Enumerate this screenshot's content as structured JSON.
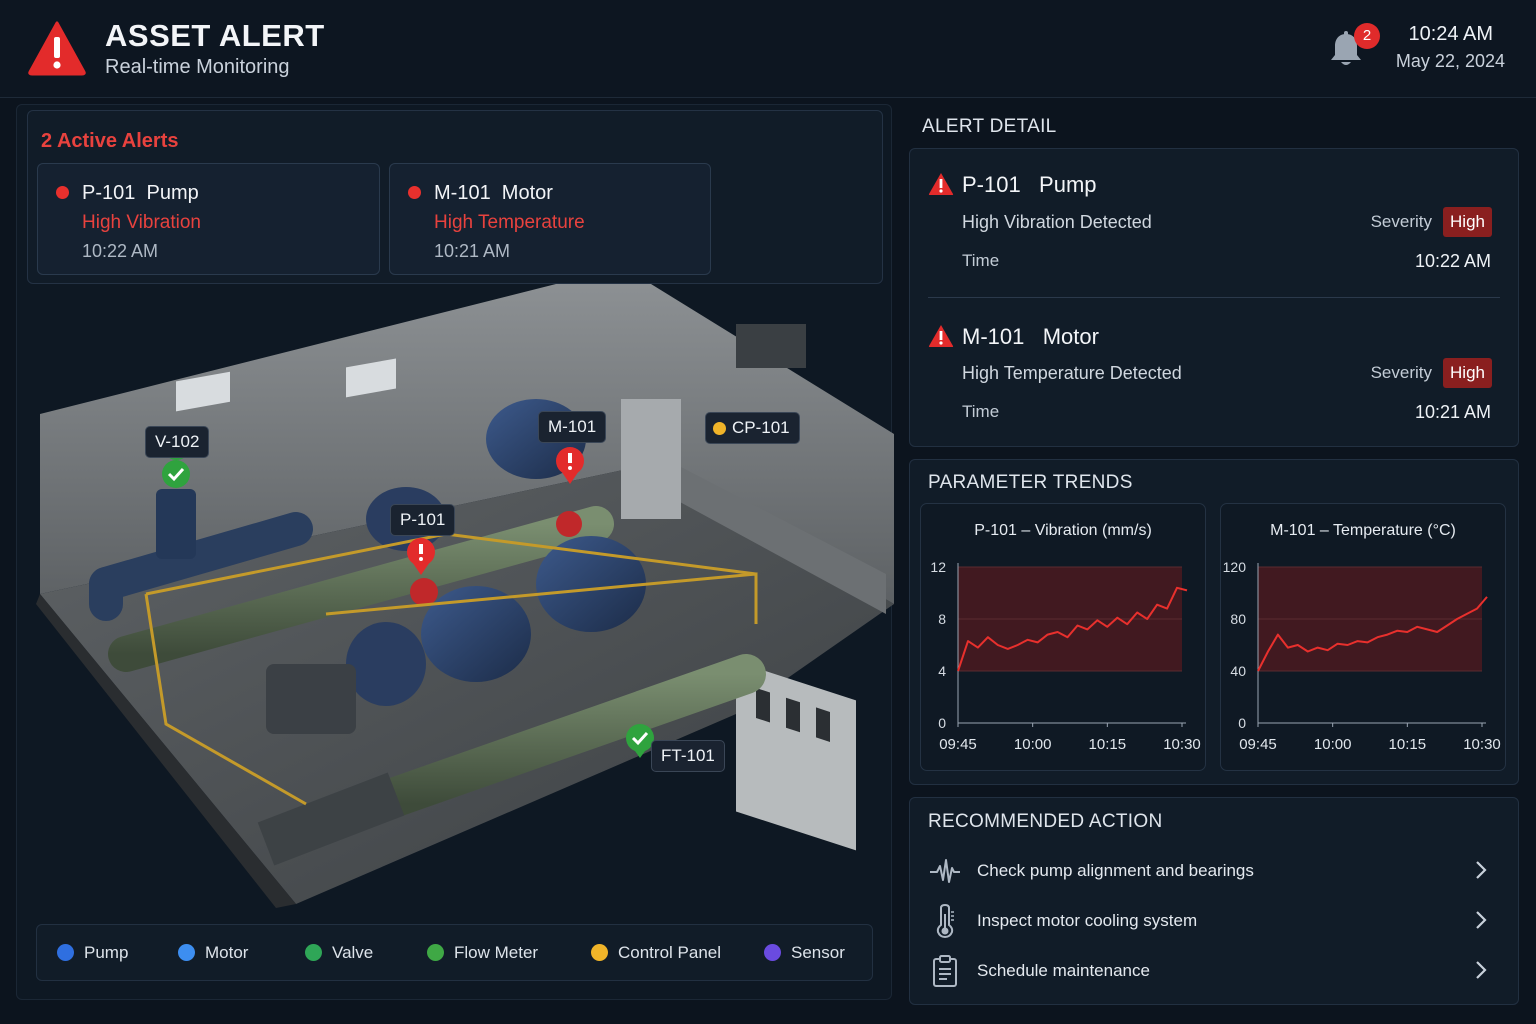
{
  "header": {
    "title": "ASSET ALERT",
    "subtitle": "Real-time Monitoring",
    "notification_count": "2",
    "time": "10:24 AM",
    "date": "May 22, 2024"
  },
  "alerts": {
    "title": "2 Active Alerts",
    "items": [
      {
        "name": "P-101  Pump",
        "issue": "High Vibration",
        "time": "10:22 AM"
      },
      {
        "name": "M-101  Motor",
        "issue": "High Temperature",
        "time": "10:21 AM"
      }
    ]
  },
  "plant": {
    "markers": [
      {
        "label": "V-102",
        "status": "ok"
      },
      {
        "label": "M-101",
        "status": "alert"
      },
      {
        "label": "CP-101",
        "status": "panel"
      },
      {
        "label": "P-101",
        "status": "alert"
      },
      {
        "label": "FT-101",
        "status": "ok"
      }
    ]
  },
  "legend": [
    {
      "label": "Pump",
      "color": "#2f6fe0"
    },
    {
      "label": "Motor",
      "color": "#3d8ef0"
    },
    {
      "label": "Valve",
      "color": "#2fa657"
    },
    {
      "label": "Flow Meter",
      "color": "#3fa845"
    },
    {
      "label": "Control Panel",
      "color": "#f0b429"
    },
    {
      "label": "Sensor",
      "color": "#6a4be0"
    }
  ],
  "detail": {
    "title": "ALERT DETAIL",
    "items": [
      {
        "name": "P-101   Pump",
        "description": "High Vibration Detected",
        "severity_label": "Severity",
        "severity": "High",
        "time_label": "Time",
        "time": "10:22 AM"
      },
      {
        "name": "M-101   Motor",
        "description": "High Temperature Detected",
        "severity_label": "Severity",
        "severity": "High",
        "time_label": "Time",
        "time": "10:21 AM"
      }
    ]
  },
  "trends": {
    "title": "PARAMETER TRENDS"
  },
  "chart_data": [
    {
      "type": "line",
      "title": "P-101 – Vibration (mm/s)",
      "x": [
        "09:45",
        "09:47",
        "09:49",
        "09:51",
        "09:53",
        "09:55",
        "09:57",
        "09:59",
        "10:01",
        "10:03",
        "10:05",
        "10:07",
        "10:09",
        "10:11",
        "10:13",
        "10:15",
        "10:17",
        "10:19",
        "10:21",
        "10:23",
        "10:25",
        "10:27",
        "10:29",
        "10:31"
      ],
      "y": [
        4.0,
        6.3,
        5.8,
        6.6,
        6.0,
        5.7,
        6.0,
        6.4,
        6.2,
        6.8,
        7.0,
        6.6,
        7.5,
        7.2,
        7.9,
        7.4,
        8.1,
        7.6,
        8.5,
        8.0,
        9.1,
        8.8,
        10.4,
        10.2
      ],
      "xticks": [
        "09:45",
        "10:00",
        "10:15",
        "10:30"
      ],
      "yticks": [
        "0",
        "4",
        "8",
        "12"
      ],
      "ylim": [
        0,
        12
      ],
      "line_color": "#e8302d",
      "alarm_band": [
        4,
        12
      ]
    },
    {
      "type": "line",
      "title": "M-101 – Temperature (°C)",
      "x": [
        "09:45",
        "09:47",
        "09:49",
        "09:51",
        "09:53",
        "09:55",
        "09:57",
        "09:59",
        "10:01",
        "10:03",
        "10:05",
        "10:07",
        "10:09",
        "10:11",
        "10:13",
        "10:15",
        "10:17",
        "10:19",
        "10:21",
        "10:23",
        "10:25",
        "10:27",
        "10:29",
        "10:31"
      ],
      "y": [
        40,
        55,
        68,
        58,
        60,
        55,
        58,
        56,
        61,
        60,
        63,
        62,
        66,
        68,
        71,
        70,
        74,
        72,
        70,
        75,
        80,
        84,
        88,
        97
      ],
      "xticks": [
        "09:45",
        "10:00",
        "10:15",
        "10:30"
      ],
      "yticks": [
        "0",
        "40",
        "80",
        "120"
      ],
      "ylim": [
        0,
        120
      ],
      "line_color": "#e8302d",
      "alarm_band": [
        40,
        120
      ]
    }
  ],
  "actions": {
    "title": "RECOMMENDED ACTION",
    "items": [
      {
        "label": "Check pump alignment and bearings",
        "icon": "waveform-icon"
      },
      {
        "label": "Inspect motor cooling system",
        "icon": "thermometer-icon"
      },
      {
        "label": "Schedule maintenance",
        "icon": "clipboard-icon"
      }
    ]
  }
}
